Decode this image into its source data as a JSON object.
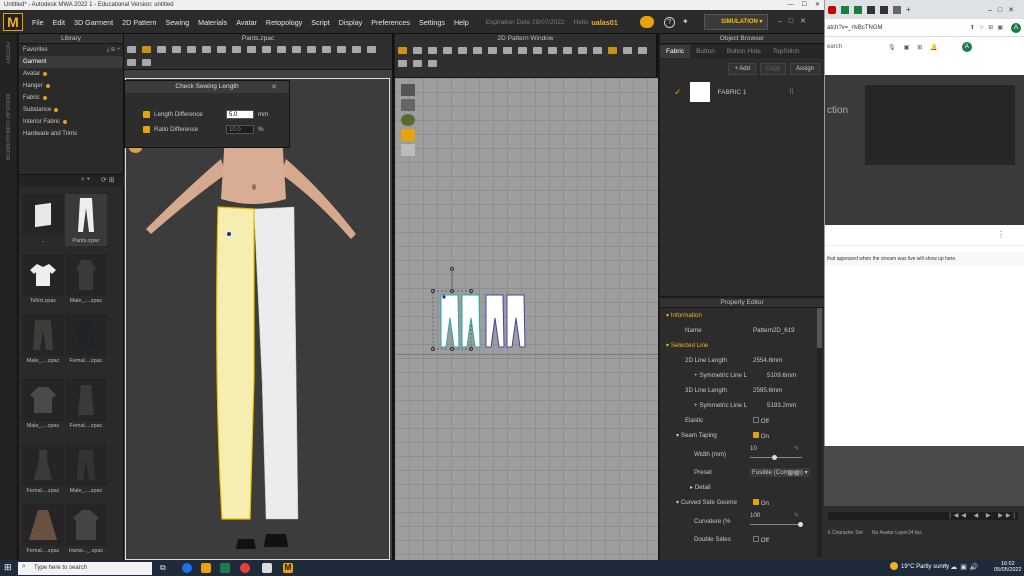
{
  "window_title": "Untitled* - Autodesk MWA 2022 1 - Educational Version: untitled",
  "menu": [
    "File",
    "Edit",
    "3D Garment",
    "2D Pattern",
    "Sewing",
    "Materials",
    "Avatar",
    "Retopology",
    "Script",
    "Display",
    "Preferences",
    "Settings",
    "Help"
  ],
  "expiry": "Expiration Date 28/07/2022",
  "user_greeting": "Hello",
  "username": "ualas01",
  "simulation_label": "SIMULATION",
  "side_strip": {
    "history": "HISTORY",
    "modular": "MODULAR CONFIGURATOR"
  },
  "library": {
    "title": "Library",
    "folders": [
      {
        "label": "Favorites"
      },
      {
        "label": "Garment"
      },
      {
        "label": "Avatar"
      },
      {
        "label": "Hanger"
      },
      {
        "label": "Fabric"
      },
      {
        "label": "Substance"
      },
      {
        "label": "Interior Fabric"
      },
      {
        "label": "Hardware and Trims"
      }
    ],
    "tiles": [
      {
        "label": ".."
      },
      {
        "label": "Pants.zpac"
      },
      {
        "label": "Tshirt.zpac"
      },
      {
        "label": "Male_....zpac"
      },
      {
        "label": "Male_....zpac"
      },
      {
        "label": "Femal....zpac"
      },
      {
        "label": "Male_....zpac"
      },
      {
        "label": "Femal....zpac"
      },
      {
        "label": "Femal....zpac"
      },
      {
        "label": "Male_....zpac"
      },
      {
        "label": "Femal....zpac"
      },
      {
        "label": "Hanw..._.zpac"
      }
    ]
  },
  "viewport3d": {
    "title": "Pants.zpac"
  },
  "sewing_dialog": {
    "title": "Check Sewing Length",
    "length_label": "Length Difference",
    "length_value": "5.0",
    "length_unit": "mm",
    "ratio_label": "Ratio Difference",
    "ratio_value": "10.0",
    "ratio_unit": "%"
  },
  "viewport2d": {
    "title": "2D Pattern Window"
  },
  "object_browser": {
    "title": "Object Browser",
    "tabs": [
      "Fabric",
      "Button",
      "Button Hole",
      "TopStitch"
    ],
    "add": "+ Add",
    "copy": "Copy",
    "assign": "Assign",
    "fabric_name": "FABRIC 1"
  },
  "property_editor": {
    "title": "Property Editor",
    "information": "Information",
    "name_label": "Name",
    "name_value": "Pattern2D_619",
    "selected_line": "Selected Line",
    "l2d_label": "2D Line Length",
    "l2d_value": "2554.8mm",
    "sym1_label": "+ Symmetric Line L",
    "sym1_value": "5109.6mm",
    "l3d_label": "3D Line Length",
    "l3d_value": "2595.6mm",
    "sym2_label": "+ Symmetric Line L",
    "sym2_value": "5193.2mm",
    "elastic_label": "Elastic",
    "elastic_value": "Off",
    "seam_label": "Seam Taping",
    "seam_value": "On",
    "width_label": "Width (mm)",
    "width_value": "10",
    "preset_label": "Preset",
    "preset_value": "Fusible (Common)",
    "detail_label": "Detail",
    "curved_label": "Curved Side Geome",
    "curved_value": "On",
    "curv_label": "Curvature (%",
    "curv_value": "100",
    "double_label": "Double Sides",
    "double_value": "Off"
  },
  "browser": {
    "url": "atch?v=_rlvBcTNGM",
    "search": "earch",
    "avatar_letter": "A",
    "video_text_1": "ction",
    "comment": "that appeared when the stream was live will show up here.",
    "char_label": "k Character Set",
    "avatar_layer": "No Avatar Layer",
    "fps": "24 fps"
  },
  "taskbar": {
    "search": "Type here to search",
    "weather": "19°C  Partly sunny",
    "time": "16:02",
    "date": "05/05/2022"
  },
  "colors": {
    "accent": "#f2b01d",
    "garment_highlight": "#f5eeb0"
  }
}
